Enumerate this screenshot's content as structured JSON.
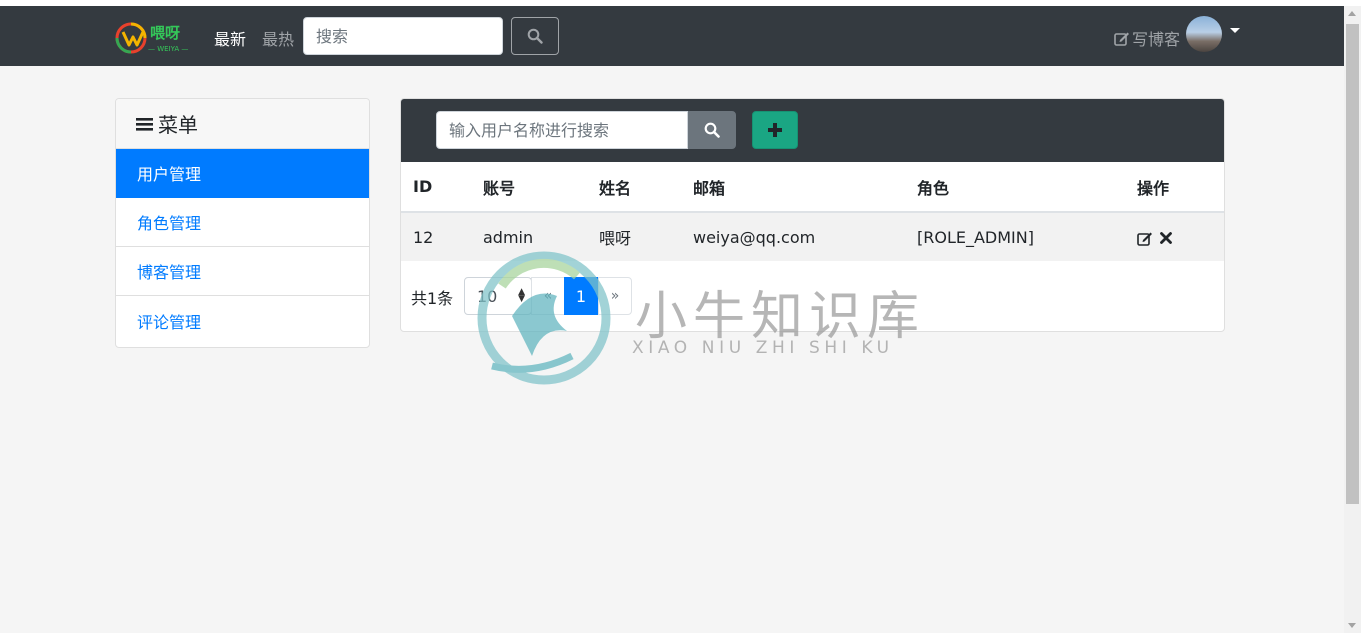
{
  "header": {
    "logo_text": "喂呀",
    "logo_sub": "— WEIYA —",
    "nav": [
      {
        "label": "最新",
        "active": true
      },
      {
        "label": "最热",
        "active": false
      }
    ],
    "search_placeholder": "搜索",
    "write_label": "写博客"
  },
  "sidebar": {
    "title": "菜单",
    "items": [
      {
        "label": "用户管理",
        "active": true
      },
      {
        "label": "角色管理",
        "active": false
      },
      {
        "label": "博客管理",
        "active": false
      },
      {
        "label": "评论管理",
        "active": false
      }
    ]
  },
  "main": {
    "search_placeholder": "输入用户名称进行搜索",
    "columns": [
      "ID",
      "账号",
      "姓名",
      "邮箱",
      "角色",
      "操作"
    ],
    "rows": [
      {
        "id": "12",
        "account": "admin",
        "name": "喂呀",
        "email": "weiya@qq.com",
        "role": "[ROLE_ADMIN]"
      }
    ],
    "pagination": {
      "total_text": "共1条",
      "page_size": "10",
      "prev": "«",
      "current": "1",
      "next": "»"
    }
  },
  "watermark": {
    "title": "小牛知识库",
    "subtitle": "XIAO NIU ZHI SHI KU"
  },
  "colors": {
    "navbar": "#343a40",
    "primary": "#007bff",
    "success": "#1aa683",
    "secondary": "#6c757d"
  },
  "icons": {
    "search": "search-icon",
    "add": "plus-icon",
    "edit": "edit-icon",
    "delete": "close-icon",
    "write": "edit-icon",
    "menu": "bars-icon"
  }
}
